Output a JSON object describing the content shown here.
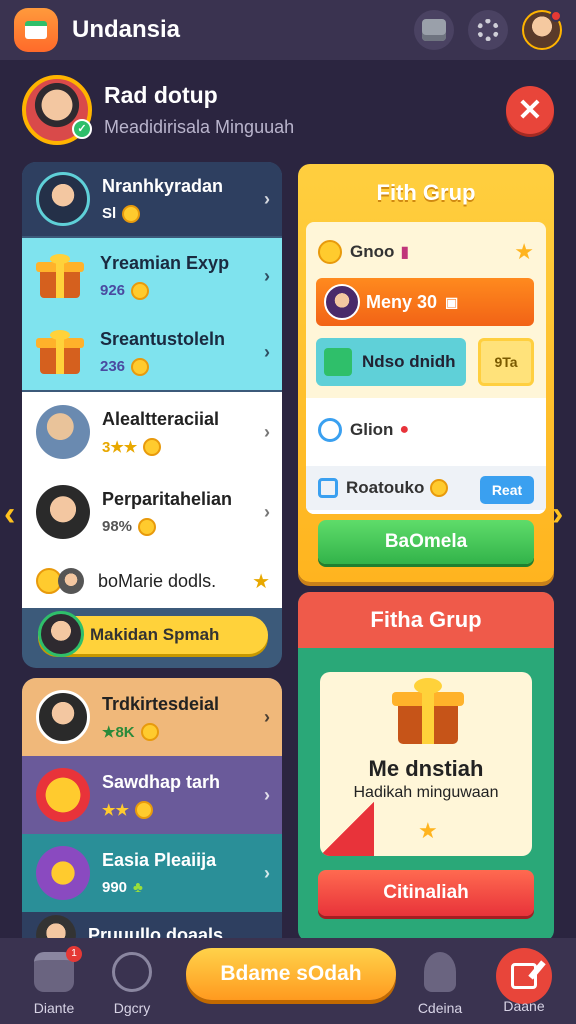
{
  "app": {
    "title": "Undansia"
  },
  "profile": {
    "name": "Rad dotup",
    "subtitle": "Meadidirisala Minguuah"
  },
  "left_list": [
    {
      "title": "Nranhkyradan",
      "value": "Sl"
    },
    {
      "title": "Yreamian Exyp",
      "value": "926"
    },
    {
      "title": "Sreantustoleln",
      "value": "236"
    },
    {
      "title": "Alealtteraciial",
      "value": "3★★"
    },
    {
      "title": "Perparitahelian",
      "value": "98%"
    },
    {
      "title": "boMarie dodls."
    }
  ],
  "left_pill": {
    "label": "Makidan Spmah"
  },
  "left_list2": [
    {
      "title": "Trdkirtesdeial",
      "value": "★8K"
    },
    {
      "title": "Sawdhap tarh",
      "value": "★★"
    },
    {
      "title": "Easia Pleaiija",
      "value": "990"
    },
    {
      "title": "Pruuullo doaals"
    }
  ],
  "card1": {
    "title": "Fith Grup",
    "row1": "Gnoo",
    "orange": "Meny 30",
    "teal": "Ndso dnidh",
    "tag": "9Ta",
    "row4": "Glion",
    "row5": "Roatouko",
    "blue_btn": "Reat",
    "green_btn": "BaOmela"
  },
  "card2": {
    "header": "Fitha Grup",
    "title": "Me dnstiah",
    "subtitle": "Hadikah minguwaan",
    "button": "Citinaliah"
  },
  "bottom_nav": {
    "item1": "Diante",
    "item2": "Dgcry",
    "play": "Bdame sOdah",
    "item4": "Cdeina",
    "item5": "Daane"
  },
  "colors": {
    "accent": "#ffb41f",
    "danger": "#e8453a",
    "success": "#32b34a"
  }
}
